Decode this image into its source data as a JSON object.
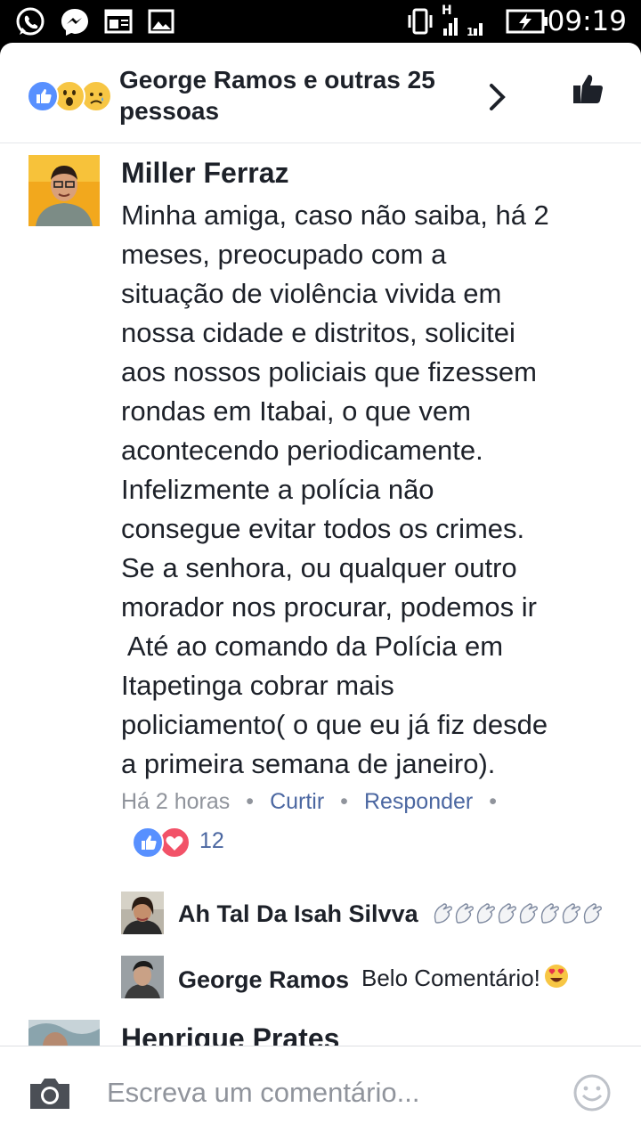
{
  "status_bar": {
    "time": "09:19",
    "left_icons": [
      "whatsapp-icon",
      "messenger-icon",
      "newspaper-icon",
      "gallery-icon"
    ],
    "right_icons": [
      "vibrate-icon",
      "signal-h-icon",
      "signal-1-icon",
      "battery-charging-icon"
    ]
  },
  "header": {
    "reactions": [
      "like",
      "wow",
      "sad"
    ],
    "title": "George Ramos e outras 25 pessoas",
    "chevron_icon": "chevron-right-icon",
    "like_icon": "thumbs-up-icon"
  },
  "main_comment": {
    "author": "Miller Ferraz",
    "text_lines": [
      "Minha amiga, caso não saiba, há 2",
      "meses, preocupado com a",
      "situação de violência vivida em",
      "nossa cidade e distritos, solicitei",
      "aos nossos policiais que fizessem",
      "rondas em Itabai, o que vem",
      "acontecendo periodicamente.",
      "Infelizmente a polícia não",
      "consegue evitar todos os crimes.",
      "Se a senhora, ou qualquer outro",
      "morador nos procurar, podemos ir",
      " Até ao comando da Polícia em",
      "Itapetinga cobrar mais",
      "policiamento( o que eu já fiz desde",
      "a primeira semana de janeiro)."
    ],
    "time": "Há 2 horas",
    "like_action": "Curtir",
    "reply_action": "Responder",
    "separator": "•",
    "reaction_count": "12"
  },
  "replies": [
    {
      "author": "Ah Tal Da Isah Silvva",
      "text": "",
      "emoji": "clap-hands-x8"
    },
    {
      "author": "George Ramos",
      "text": "Belo Comentário!",
      "emoji": "heart-eyes-emoji"
    }
  ],
  "next_comment": {
    "author": "Henrique Prates"
  },
  "composer": {
    "placeholder": "Escreva um comentário...",
    "camera_icon": "camera-icon",
    "emoji_icon": "smiley-icon"
  },
  "colors": {
    "like_blue": "#5890ff",
    "love_red": "#f25268",
    "link_blue": "#4b67a1",
    "muted_gray": "#90949c",
    "text": "#1d2129"
  }
}
